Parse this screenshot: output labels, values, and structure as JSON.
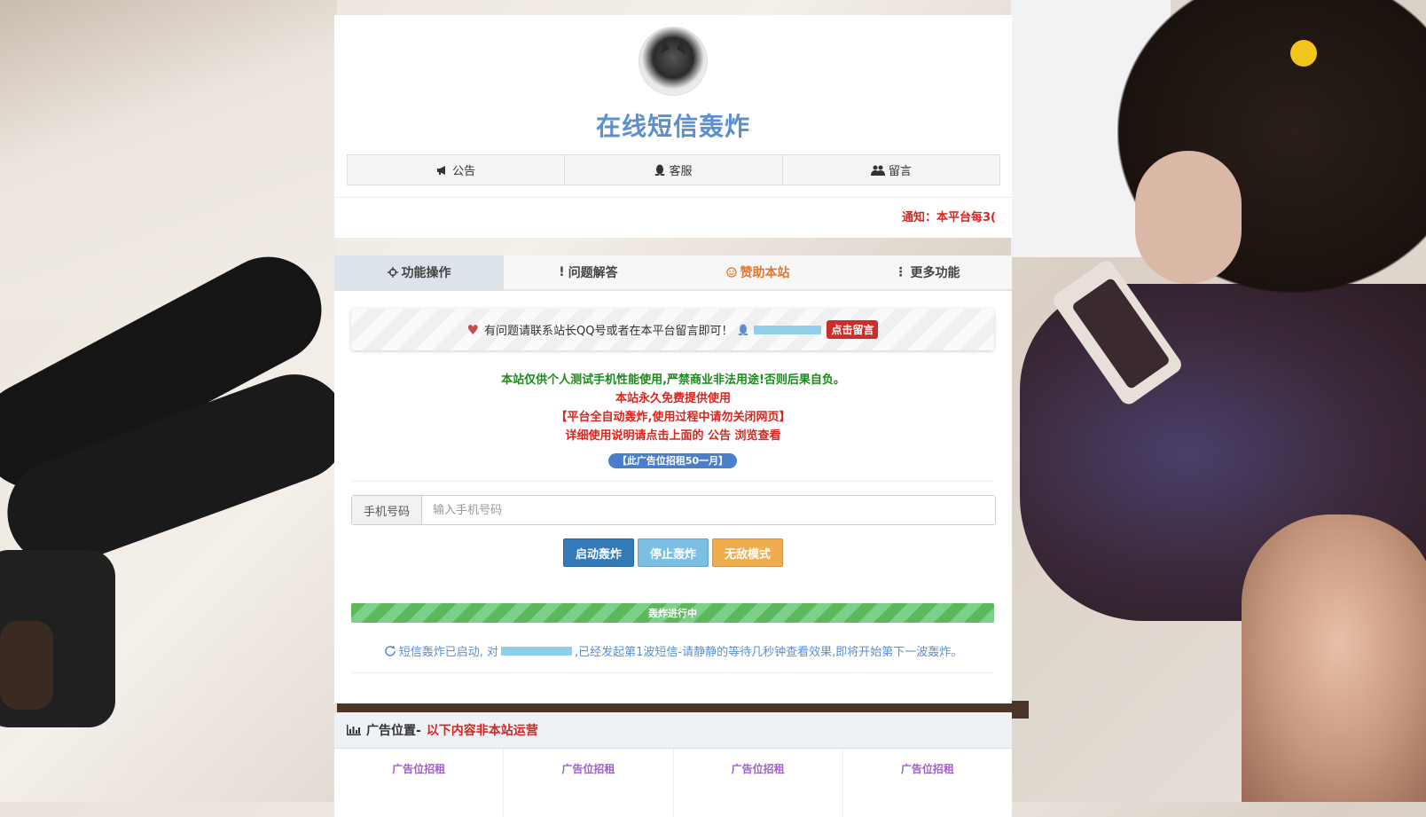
{
  "site": {
    "title": "在线短信轰炸",
    "nav": [
      {
        "icon": "megaphone-icon",
        "label": "公告"
      },
      {
        "icon": "qq-penguin-icon",
        "label": "客服"
      },
      {
        "icon": "users-icon",
        "label": "留言"
      }
    ],
    "notice": "通知：本平台每3("
  },
  "tabs": [
    {
      "icon": "crosshair-icon",
      "label": "功能操作",
      "active": true
    },
    {
      "icon": "exclamation-icon",
      "label": "问题解答"
    },
    {
      "icon": "smile-icon",
      "label": "赞助本站"
    },
    {
      "icon": "vertical-dots-icon",
      "label": "更多功能"
    }
  ],
  "contact": {
    "text": "有问题请联系站长QQ号或者在本平台留言即可！",
    "button": "点击留言"
  },
  "disclaimers": [
    "本站仅供个人测试手机性能使用,严禁商业非法用途!否则后果自负。",
    "本站永久免费提供使用",
    "【平台全自动轰炸,使用过程中请勿关闭网页】",
    "详细使用说明请点击上面的 公告 浏览查看"
  ],
  "ad_pill": "【此广告位招租50一月】",
  "form": {
    "phone_label": "手机号码",
    "phone_placeholder": "输入手机号码",
    "start_button": "启动轰炸",
    "stop_button": "停止轰炸",
    "god_button": "无敌模式"
  },
  "progress": {
    "label": "轰炸进行中",
    "percent": 100
  },
  "status": {
    "prefix": "短信轰炸已启动, 对",
    "suffix": ",已经发起第1波短信-请静静的等待几秒钟查看效果,即将开始第下一波轰炸。"
  },
  "ads": {
    "title": "广告位置-",
    "title_red": "以下内容非本站运营",
    "cells": [
      "广告位招租",
      "广告位招租",
      "广告位招租",
      "广告位招租"
    ]
  },
  "colors": {
    "brand_blue": "#5b8fcf",
    "red": "#d9251d",
    "green": "#1a8a1a",
    "sponsor_orange": "#e2762c"
  }
}
